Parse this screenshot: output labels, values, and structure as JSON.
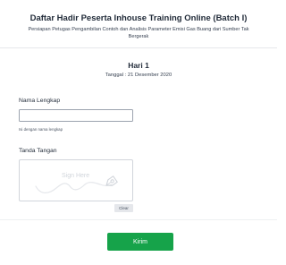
{
  "form": {
    "title": "Daftar Hadir Peserta Inhouse Training Online (Batch I)",
    "subtitle": "Persiapan Petugas Pengambilan Contoh dan Analisis Parameter Emisi Gas Buang dari Sumber Tak Bergerak"
  },
  "session": {
    "day": "Hari 1",
    "date": "Tanggal : 21 Desember 2020"
  },
  "fields": {
    "name": {
      "label": "Nama Lengkap",
      "value": "",
      "placeholder": "",
      "hint": "Isi dengan nama lengkap"
    },
    "signature": {
      "label": "Tanda Tangan",
      "placeholder": "Sign Here",
      "icon": "pen-nib-icon",
      "clear_label": "Clear"
    }
  },
  "actions": {
    "submit_label": "Kirim"
  },
  "colors": {
    "accent": "#16a34a",
    "clear_bg": "#e5e7eb",
    "placeholder": "#d1d5db"
  }
}
